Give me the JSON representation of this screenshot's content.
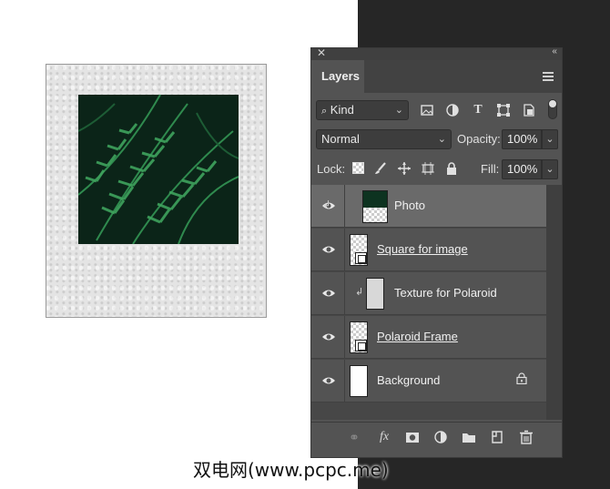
{
  "panel": {
    "tab": "Layers",
    "filter": {
      "label": "Kind"
    },
    "blend_mode": "Normal",
    "opacity_label": "Opacity:",
    "opacity_value": "100%",
    "lock_label": "Lock:",
    "fill_label": "Fill:",
    "fill_value": "100%"
  },
  "layers": [
    {
      "name": "Photo",
      "selected": true,
      "clipped": true,
      "underline": false
    },
    {
      "name": "Square for image",
      "selected": false,
      "clipped": false,
      "underline": true
    },
    {
      "name": "Texture for Polaroid",
      "selected": false,
      "clipped": true,
      "underline": false
    },
    {
      "name": "Polaroid Frame",
      "selected": false,
      "clipped": false,
      "underline": true
    },
    {
      "name": "Background",
      "selected": false,
      "clipped": false,
      "underline": false,
      "locked": true
    }
  ],
  "watermark": "双电网(www.pcpc.me)",
  "colors": {
    "panel": "#535353",
    "selected_row": "#6a6a6a",
    "fern": "#2e7d4a"
  }
}
